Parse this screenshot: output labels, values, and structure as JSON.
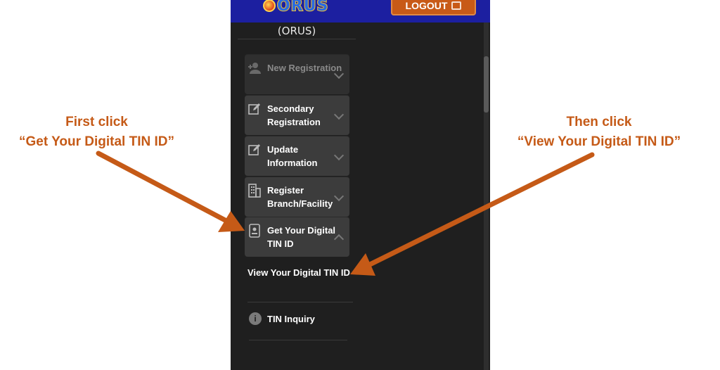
{
  "header": {
    "logo_text": "ORUS",
    "logout_label": "LOGOUT"
  },
  "sidebar": {
    "portal_name": "(ORUS)",
    "items": [
      {
        "label": "New Registration",
        "icon": "user-add-icon",
        "state": "disabled"
      },
      {
        "label": "Secondary Registration",
        "icon": "edit-icon",
        "state": "collapsed"
      },
      {
        "label": "Update Information",
        "icon": "edit-icon",
        "state": "collapsed"
      },
      {
        "label": "Register Branch/Facility",
        "icon": "building-icon",
        "state": "collapsed"
      },
      {
        "label": "Get Your Digital TIN ID",
        "icon": "id-card-icon",
        "state": "expanded"
      }
    ],
    "subitem": {
      "label": "View Your Digital TIN ID"
    },
    "tin_inquiry": {
      "label": "TIN Inquiry",
      "icon": "info-icon",
      "glyph": "i"
    }
  },
  "annotations": {
    "left_line1": "First click",
    "left_line2": "“Get Your Digital TIN ID”",
    "right_line1": "Then click",
    "right_line2": "“View Your Digital TIN ID”",
    "color": "#c55a17"
  },
  "colors": {
    "header_bg": "#1c1fa0",
    "logout_bg": "#c85a17",
    "panel_bg": "#1f1f1f",
    "menu_item_bg": "#3c3c3c"
  }
}
